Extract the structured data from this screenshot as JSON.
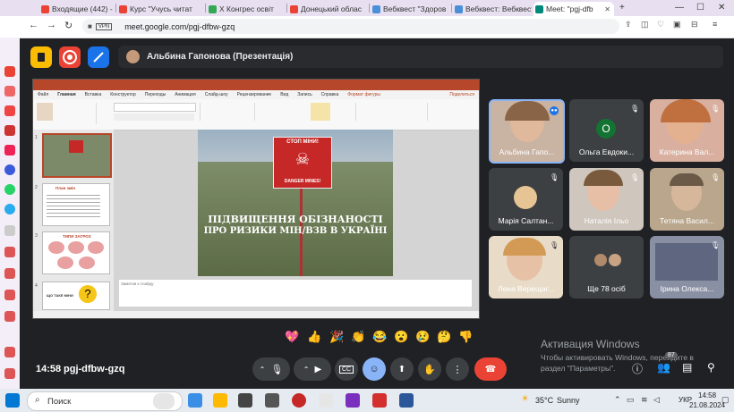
{
  "browser": {
    "tabs": [
      {
        "label": "Входящие (442) -",
        "color": "#ea4335"
      },
      {
        "label": "Курс \"Учусь читат",
        "color": "#ea4335"
      },
      {
        "label": "X Конгрес освіт",
        "color": "#34a853"
      },
      {
        "label": "Донецький облас",
        "color": "#ea4335"
      },
      {
        "label": "Вебквест \"Здоров",
        "color": "#4a90d9"
      },
      {
        "label": "Вебквест: Вебквест",
        "color": "#4a90d9"
      },
      {
        "label": "Meet: \"pgj-dfb",
        "color": "#00897b"
      }
    ],
    "new_tab": "+",
    "url": "meet.google.com/pgj-dfbw-gzq",
    "vpn": "VPN"
  },
  "meet": {
    "presenter_label": "Альбина Гапонова (Презентація)",
    "time": "14:58",
    "meeting_code": "pgj-dfbw-gzq",
    "participants_count": "87",
    "reactions": [
      "💖",
      "👍",
      "🎉",
      "👏",
      "😂",
      "😮",
      "😢",
      "🤔",
      "👎"
    ],
    "participants": [
      {
        "name": "Альбина Гапо...",
        "speaking": true
      },
      {
        "name": "Ольга Евдоки...",
        "initial": "О"
      },
      {
        "name": "Катерина Вал..."
      },
      {
        "name": "Марія Салтан..."
      },
      {
        "name": "Наталія Ільо"
      },
      {
        "name": "Тетяна Васил..."
      },
      {
        "name": "Лена Верещаг..."
      },
      {
        "name": "Ще 78 осіб"
      },
      {
        "name": "Ірина Олекса..."
      }
    ]
  },
  "ppt": {
    "menu": [
      "Файл",
      "Главная",
      "Вставка",
      "Конструктор",
      "Переходы",
      "Анимация",
      "Слайд-шоу",
      "Рецензирование",
      "Вид",
      "Запись",
      "Справка",
      "Формат фигуры"
    ],
    "share": "Поделиться",
    "slide_sign_top": "СТОП МІНИ!",
    "slide_sign_bottom": "DANGER MINES!",
    "slide_title_line1": "ПІДВИЩЕННЯ ОБІЗНАНОСТІ",
    "slide_title_line2": "ПРО РИЗИКИ МІН/ВЗВ В УКРАЇНІ",
    "notes_placeholder": "Заметки к слайду",
    "thumb2_title": "План змін",
    "thumb3_title": "ТИПИ ЗАГРОЗ",
    "thumb4_title": "ЩО ТАКЕ МІНИ"
  },
  "windows": {
    "activation_title": "Активация Windows",
    "activation_text_1": "Чтобы активировать Windows, перейдите в",
    "activation_text_2": "раздел \"Параметры\".",
    "search": "Поиск",
    "weather_temp": "35°C",
    "weather_text": "Sunny",
    "lang": "УКР",
    "clock_time": "14:58",
    "clock_date": "21.08.2024"
  },
  "colors": {
    "accent": "#8ab4f8",
    "end_call": "#ea4335",
    "ppt": "#b7472a"
  }
}
